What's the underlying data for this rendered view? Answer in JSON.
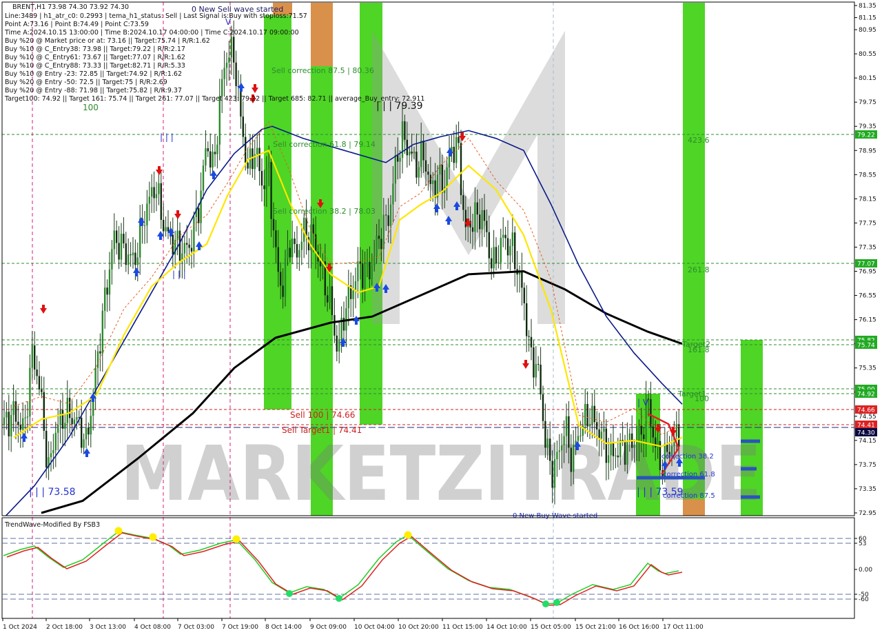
{
  "symbol_line": "BRENT,H1  73.98 74.30 73.92 74.30",
  "info_lines": [
    "Line:3489 | h1_atr_c0: 0.2993 | tema_h1_status: Sell | Last Signal is:Buy with stoploss:71.57",
    "Point A:73.16 | Point B:74.49 | Point C:73.59",
    "Time A:2024.10.15 13:00:00 | Time B:2024.10.17 04:00:00 | Time C:2024.10.17 09:00:00",
    "Buy %20 @ Market price or at: 73.16 || Target:75.74 | R/R:1.62",
    "Buy %10 @ C_Entry38: 73.98 || Target:79.22 | R/R:2.17",
    "Buy %10 @ C_Entry61: 73.67 || Target:77.07 | R/R:1.62",
    "Buy %10 @ C_Entry88: 73.33 || Target:82.71 | R/R:5.33",
    "Buy %10 @ Entry -23: 72.85 || Target:74.92 | R/R:1.62",
    "Buy %20 @ Entry -50: 72.5 || Target:75 | R/R:2.69",
    "Buy %20 @ Entry -88: 71.98 || Target:75.82 | R/R:9.37",
    "Target100: 74.92 || Target 161: 75.74 || Target 261: 77.07 || Target 423: 79.22 || Target 685: 82.71 || average_Buy_entry: 72.911"
  ],
  "chart_labels": {
    "top_100": "100",
    "new_sell": "0 New Sell wave started",
    "sell_corr_875": "Sell correction 87.5 | 80.36",
    "sell_corr_618": "Sell correction 61.8 | 79.14",
    "sell_corr_382": "Sell correction 38.2 | 78.03",
    "price_7939": "| | | 79.39",
    "sell_100": "Sell 100 | 74.66",
    "sell_target1": "Sell Target1 | 74.41",
    "price_7358": "| | | 73.58",
    "price_7359": "| | | 73.59",
    "new_buy": "0 New Buy Wave started",
    "f423": "423.6",
    "f261": "261.8",
    "f161": "161.8",
    "f100": "100",
    "target2": "Target2",
    "target1": "Target1",
    "corr382": "correction 38.2",
    "corr618": "correction 61.8",
    "corr875": "correction 87.5",
    "wave_iii_a": "| | |",
    "wave_v": "V",
    "wave_iv": "| V",
    "wave_iii_b": "| | |"
  },
  "watermark": "MARKETZITRADE",
  "price_axis": [
    "81.35",
    "81.15",
    "80.95",
    "80.55",
    "80.15",
    "79.75",
    "79.35",
    "78.95",
    "78.55",
    "78.15",
    "77.75",
    "77.35",
    "76.95",
    "76.55",
    "76.15",
    "75.75",
    "75.35",
    "74.95",
    "74.55",
    "74.15",
    "73.75",
    "73.35",
    "72.95"
  ],
  "price_tags": [
    {
      "text": "79.22",
      "color": "#22aa22"
    },
    {
      "text": "77.07",
      "color": "#22aa22"
    },
    {
      "text": "75.82",
      "color": "#22aa22"
    },
    {
      "text": "75.74",
      "color": "#22aa22"
    },
    {
      "text": "75.00",
      "color": "#22aa22"
    },
    {
      "text": "74.92",
      "color": "#22aa22"
    },
    {
      "text": "74.66",
      "color": "#dd2222"
    },
    {
      "text": "74.41",
      "color": "#dd2222"
    },
    {
      "text": "74.30",
      "color": "#0a0a40"
    }
  ],
  "time_axis": [
    "1 Oct 2024",
    "2 Oct 18:00",
    "3 Oct 13:00",
    "4 Oct 08:00",
    "7 Oct 03:00",
    "7 Oct 19:00",
    "8 Oct 14:00",
    "9 Oct 09:00",
    "10 Oct 04:00",
    "10 Oct 20:00",
    "11 Oct 15:00",
    "14 Oct 10:00",
    "15 Oct 05:00",
    "15 Oct 21:00",
    "16 Oct 16:00",
    "17 Oct 11:00"
  ],
  "indicator": {
    "title": "TrendWave-Modified By FSB3",
    "levels": [
      "60",
      "53",
      "0.00",
      "-50",
      "-60"
    ]
  },
  "chart_data": {
    "type": "candlestick",
    "ylim": [
      72.95,
      81.35
    ],
    "tema_blue_curve": [
      [
        0,
        72.8
      ],
      [
        50,
        73.4
      ],
      [
        100,
        74.2
      ],
      [
        140,
        75.0
      ],
      [
        180,
        75.8
      ],
      [
        220,
        76.6
      ],
      [
        260,
        77.4
      ],
      [
        300,
        78.3
      ],
      [
        340,
        78.9
      ],
      [
        380,
        79.3
      ],
      [
        395,
        79.35
      ],
      [
        440,
        79.15
      ],
      [
        500,
        78.95
      ],
      [
        560,
        78.75
      ],
      [
        600,
        79.05
      ],
      [
        640,
        79.18
      ],
      [
        680,
        79.28
      ],
      [
        720,
        79.15
      ],
      [
        760,
        78.95
      ],
      [
        800,
        78.05
      ],
      [
        840,
        77.05
      ],
      [
        880,
        76.2
      ],
      [
        920,
        75.6
      ],
      [
        960,
        75.1
      ],
      [
        990,
        74.75
      ]
    ],
    "ma_black_curve": [
      [
        60,
        72.95
      ],
      [
        120,
        73.15
      ],
      [
        200,
        73.85
      ],
      [
        280,
        74.6
      ],
      [
        340,
        75.35
      ],
      [
        400,
        75.85
      ],
      [
        480,
        76.1
      ],
      [
        540,
        76.2
      ],
      [
        600,
        76.5
      ],
      [
        680,
        76.9
      ],
      [
        760,
        76.95
      ],
      [
        820,
        76.65
      ],
      [
        880,
        76.25
      ],
      [
        940,
        75.95
      ],
      [
        990,
        75.75
      ]
    ],
    "yellow_curve": [
      [
        20,
        74.2
      ],
      [
        60,
        74.5
      ],
      [
        100,
        74.6
      ],
      [
        140,
        74.9
      ],
      [
        180,
        75.9
      ],
      [
        220,
        76.7
      ],
      [
        260,
        77.1
      ],
      [
        300,
        77.4
      ],
      [
        330,
        78.2
      ],
      [
        360,
        78.8
      ],
      [
        390,
        78.95
      ],
      [
        420,
        78.1
      ],
      [
        450,
        77.4
      ],
      [
        480,
        76.9
      ],
      [
        520,
        76.6
      ],
      [
        550,
        76.7
      ],
      [
        580,
        77.8
      ],
      [
        610,
        78.05
      ],
      [
        640,
        78.25
      ],
      [
        680,
        78.7
      ],
      [
        720,
        78.3
      ],
      [
        760,
        77.55
      ],
      [
        800,
        76.3
      ],
      [
        840,
        74.4
      ],
      [
        880,
        74.1
      ],
      [
        920,
        74.15
      ],
      [
        960,
        74.05
      ],
      [
        990,
        74.2
      ]
    ],
    "levels": {
      "target423": 79.22,
      "target261": 77.07,
      "target2_a": 75.82,
      "target2_b": 75.74,
      "target1_a": 75.0,
      "target1_b": 74.92,
      "sell100": 74.66,
      "sell_target1": 74.41,
      "last": 74.3
    }
  }
}
